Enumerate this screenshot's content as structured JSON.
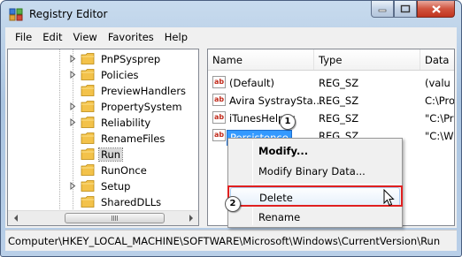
{
  "window": {
    "title": "Registry Editor"
  },
  "menubar": {
    "items": [
      "File",
      "Edit",
      "View",
      "Favorites",
      "Help"
    ]
  },
  "tree": {
    "items": [
      {
        "label": "PnPSysprep",
        "expandable": true,
        "selected": false
      },
      {
        "label": "Policies",
        "expandable": true,
        "selected": false
      },
      {
        "label": "PreviewHandlers",
        "expandable": false,
        "selected": false
      },
      {
        "label": "PropertySystem",
        "expandable": true,
        "selected": false
      },
      {
        "label": "Reliability",
        "expandable": true,
        "selected": false
      },
      {
        "label": "RenameFiles",
        "expandable": false,
        "selected": false
      },
      {
        "label": "Run",
        "expandable": false,
        "selected": true
      },
      {
        "label": "RunOnce",
        "expandable": false,
        "selected": false
      },
      {
        "label": "Setup",
        "expandable": true,
        "selected": false
      },
      {
        "label": "SharedDLLs",
        "expandable": false,
        "selected": false
      }
    ]
  },
  "list": {
    "columns": [
      "Name",
      "Type",
      "Data"
    ],
    "rows": [
      {
        "name": "(Default)",
        "type": "REG_SZ",
        "data": "(valu"
      },
      {
        "name": "Avira SystraySta...",
        "type": "REG_SZ",
        "data": "C:\\Pro"
      },
      {
        "name": "iTunesHelper",
        "type": "REG_SZ",
        "data": "\"C:\\Pr"
      },
      {
        "name": "Persistence",
        "type": "REG_SZ",
        "data": "\"C:\\W"
      }
    ],
    "selected_row": 3,
    "value_icon": "string-value-icon",
    "value_icon_text": "ab"
  },
  "context_menu": {
    "items": [
      {
        "label": "Modify...",
        "default": true
      },
      {
        "label": "Modify Binary Data...",
        "default": false
      },
      {
        "label": "Delete",
        "default": false,
        "highlighted": true
      },
      {
        "label": "Rename",
        "default": false
      }
    ]
  },
  "annotations": {
    "step1": "1",
    "step2": "2",
    "color": "#e02020"
  },
  "statusbar": {
    "path": "Computer\\HKEY_LOCAL_MACHINE\\SOFTWARE\\Microsoft\\Windows\\CurrentVersion\\Run"
  },
  "colors": {
    "selection": "#3399ff",
    "folder": "#f3c24a",
    "close_button": "#c8412c"
  }
}
